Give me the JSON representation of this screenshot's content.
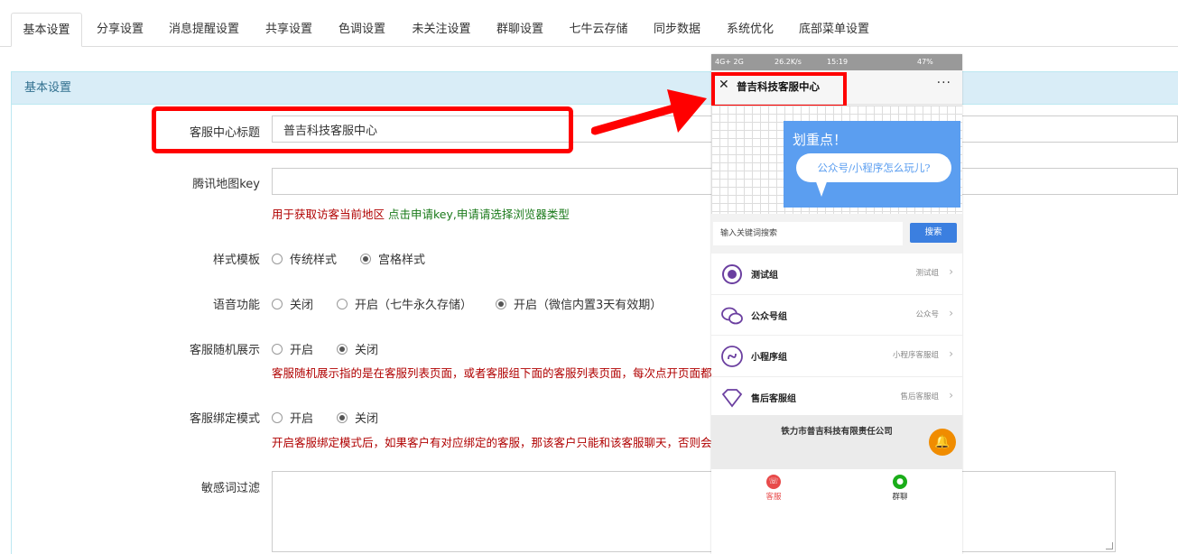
{
  "tabs": [
    {
      "label": "基本设置",
      "active": true
    },
    {
      "label": "分享设置"
    },
    {
      "label": "消息提醒设置"
    },
    {
      "label": "共享设置"
    },
    {
      "label": "色调设置"
    },
    {
      "label": "未关注设置"
    },
    {
      "label": "群聊设置"
    },
    {
      "label": "七牛云存储"
    },
    {
      "label": "同步数据"
    },
    {
      "label": "系统优化"
    },
    {
      "label": "底部菜单设置"
    }
  ],
  "panel": {
    "title": "基本设置"
  },
  "form": {
    "title_label": "客服中心标题",
    "title_value": "普吉科技客服中心",
    "map_label": "腾讯地图key",
    "map_value": "",
    "map_help_red": "用于获取访客当前地区",
    "map_help_green": "点击申请key,申请请选择浏览器类型",
    "style_label": "样式模板",
    "style_opt1": "传统样式",
    "style_opt2": "宫格样式",
    "voice_label": "语音功能",
    "voice_opt1": "关闭",
    "voice_opt2": "开启（七牛永久存储）",
    "voice_opt3": "开启（微信内置3天有效期）",
    "random_label": "客服随机展示",
    "random_opt1": "开启",
    "random_opt2": "关闭",
    "random_help": "客服随机展示指的是在客服列表页面，或者客服组下面的客服列表页面，每次点开页面都",
    "bind_label": "客服绑定模式",
    "bind_opt1": "开启",
    "bind_opt2": "关闭",
    "bind_help": "开启客服绑定模式后，如果客户有对应绑定的客服，那该客户只能和该客服聊天，否则会",
    "filter_label": "敏感词过滤"
  },
  "phone": {
    "status_left": "4G+ 2G",
    "status_speed": "26.2K/s",
    "status_time": "15:19",
    "status_battery": "47%",
    "title": "普吉科技客服中心",
    "banner_heading": "划重点！",
    "banner_bubble": "公众号/小程序怎么玩儿?",
    "search_placeholder": "输入关键词搜索",
    "search_button": "搜索",
    "groups": [
      {
        "name": "测试组",
        "sub": "测试组",
        "color": "#6b3fa0"
      },
      {
        "name": "公众号组",
        "sub": "公众号",
        "color": "#6b3fa0"
      },
      {
        "name": "小程序组",
        "sub": "小程序客服组",
        "color": "#6b3fa0"
      },
      {
        "name": "售后客服组",
        "sub": "售后客服组",
        "color": "#6b3fa0"
      }
    ],
    "company": "铁力市普吉科技有限责任公司",
    "nav_kefu": "客服",
    "nav_qunliao": "群聊"
  }
}
